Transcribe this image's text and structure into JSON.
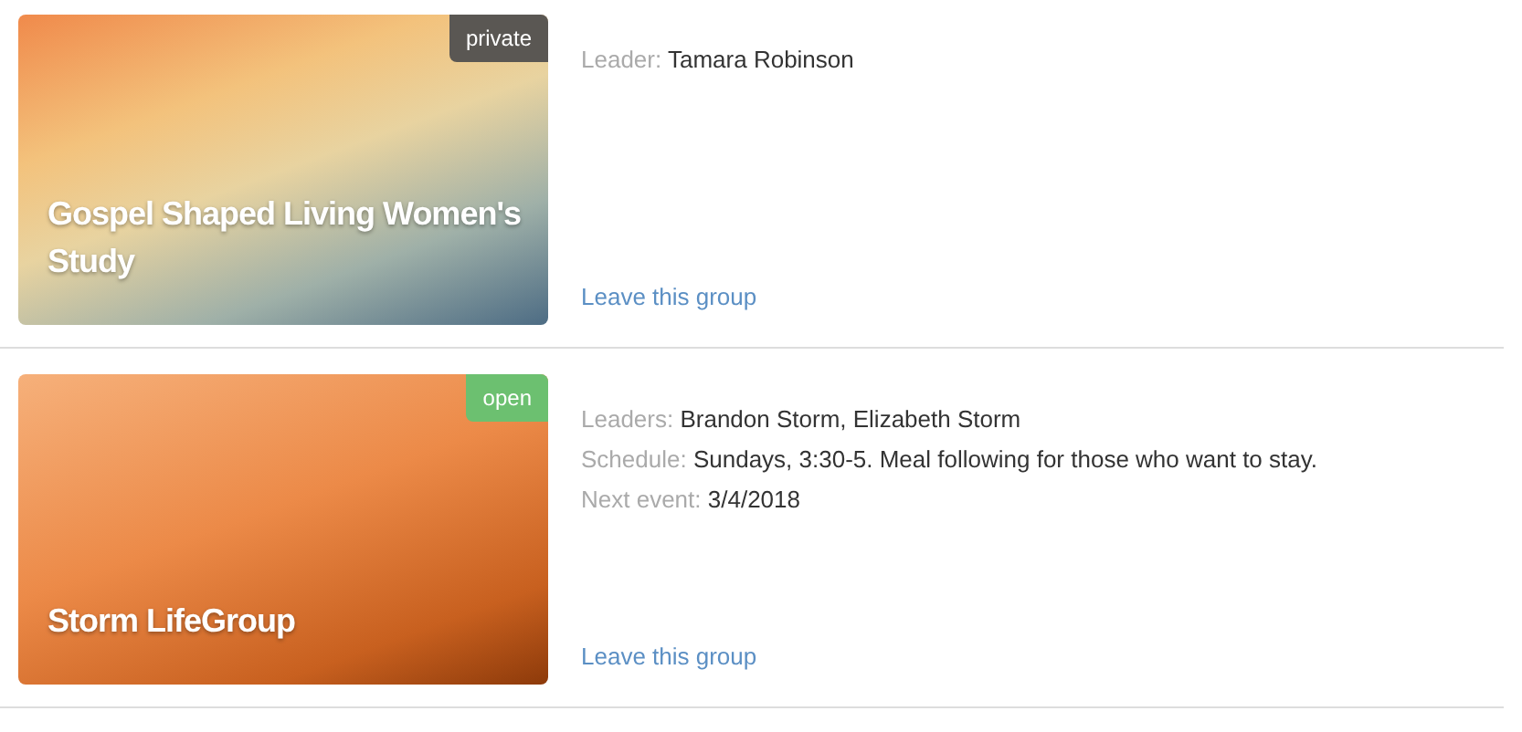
{
  "groups": [
    {
      "title": "Gospel Shaped Living Women's Study",
      "badge": {
        "label": "private",
        "kind": "private"
      },
      "fields": [
        {
          "label": "Leader:",
          "value": "Tamara Robinson"
        }
      ],
      "action": "Leave this group"
    },
    {
      "title": "Storm LifeGroup",
      "badge": {
        "label": "open",
        "kind": "open"
      },
      "fields": [
        {
          "label": "Leaders:",
          "value": "Brandon Storm, Elizabeth Storm"
        },
        {
          "label": "Schedule:",
          "value": "Sundays, 3:30-5. Meal following for those who want to stay."
        },
        {
          "label": "Next event:",
          "value": "3/4/2018"
        }
      ],
      "action": "Leave this group"
    }
  ]
}
